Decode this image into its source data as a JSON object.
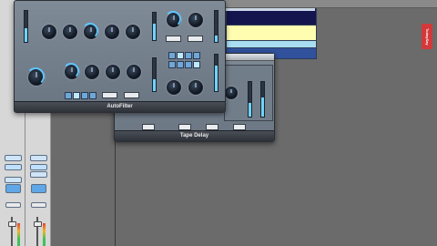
{
  "plugins": {
    "autofilter": {
      "title": "AutoFilter"
    },
    "tape_delay": {
      "title": "Tape Delay"
    }
  },
  "side_badge": {
    "text": "TodaySay"
  },
  "regions": {
    "colors": {
      "top": "#14154f",
      "yellow": "#fffdb0",
      "cyan": "#a9ddf2",
      "blue": "#31519c"
    }
  },
  "controls": {
    "accent": "#5ec6ff",
    "level_fill": 0.7
  }
}
